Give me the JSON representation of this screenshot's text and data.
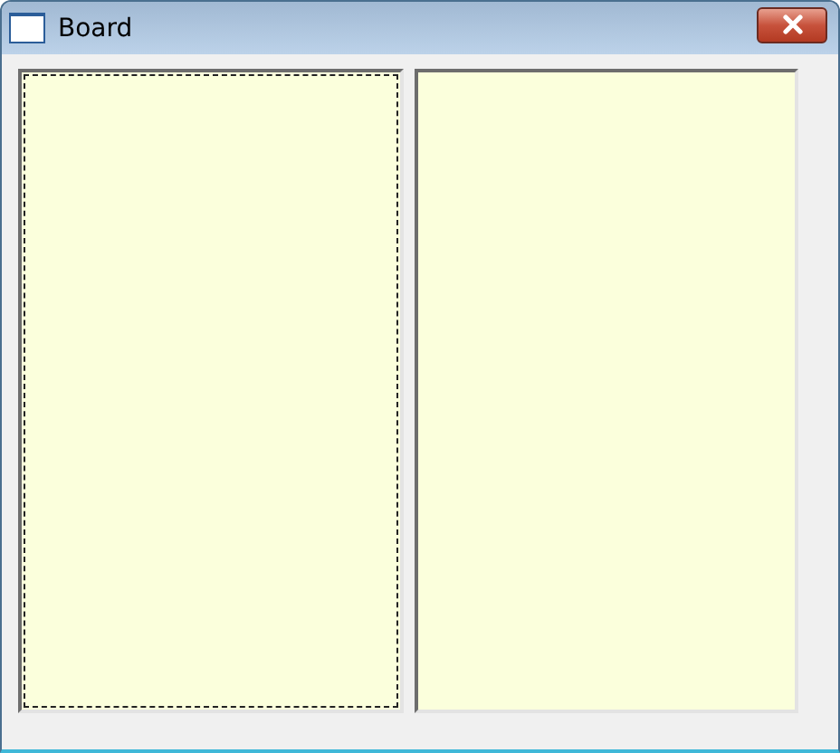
{
  "window": {
    "title": "Board"
  },
  "panels": [
    {
      "focused": true
    },
    {
      "focused": false
    }
  ]
}
